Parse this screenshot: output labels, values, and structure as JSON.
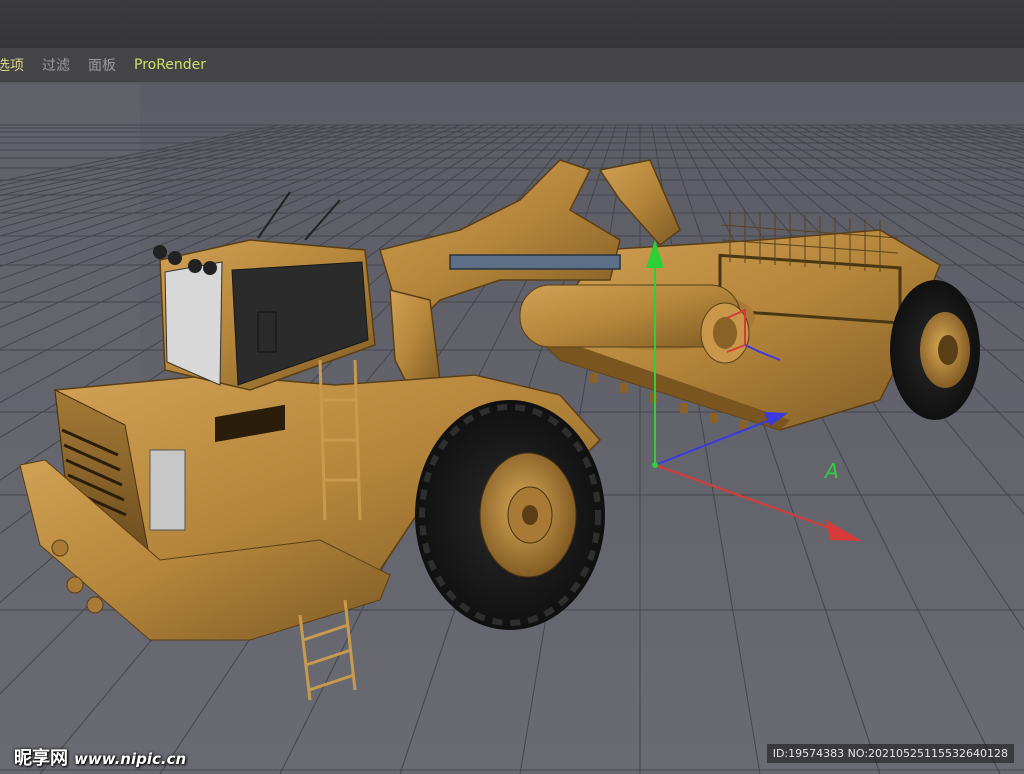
{
  "menu": {
    "items": [
      {
        "label": "选项"
      },
      {
        "label": "过滤"
      },
      {
        "label": "面板"
      },
      {
        "label": "ProRender"
      }
    ]
  },
  "viewport": {
    "gizmo_axis_label": "A"
  },
  "watermark": {
    "logo_text": "昵享网",
    "url": "www.nipic.cn",
    "id_text": "ID:19574383 NO:20210525115532640128"
  },
  "colors": {
    "background": "#5e5e67",
    "grid": "#3f3f45",
    "axis_x": "#d83a3a",
    "axis_y": "#2fcf3a",
    "axis_z": "#3a3adf",
    "vehicle": "#b88a3e"
  }
}
